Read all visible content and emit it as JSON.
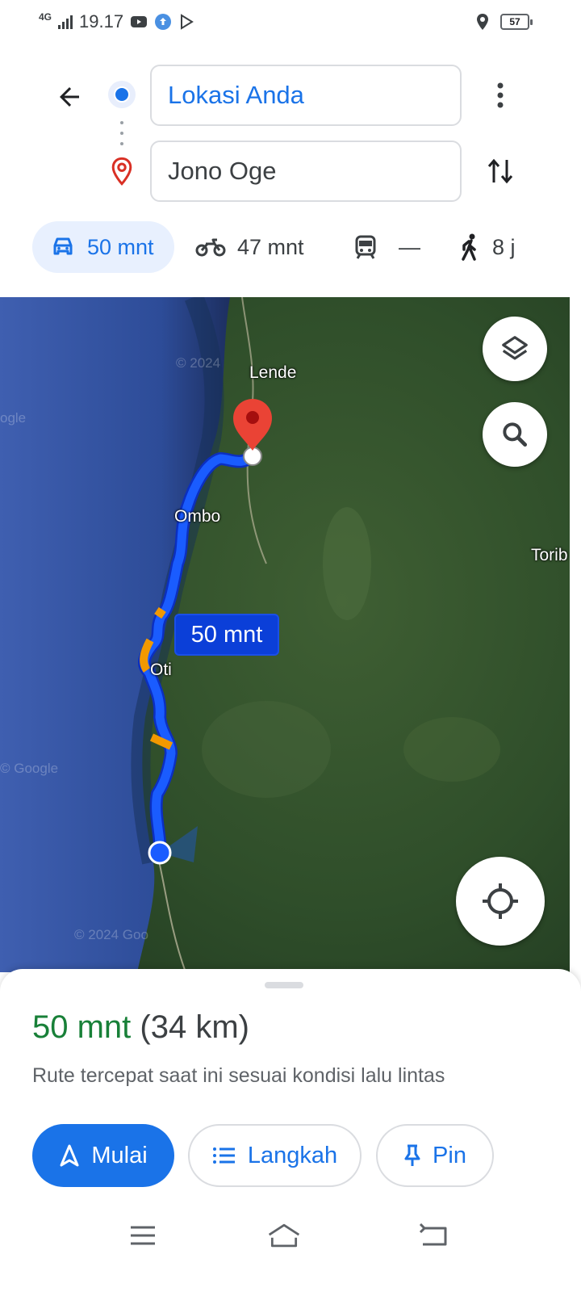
{
  "status_bar": {
    "network": "4G",
    "time": "19.17",
    "battery": "57",
    "icons": [
      "youtube-icon",
      "cloud-upload-icon",
      "play-store-icon",
      "location-icon",
      "battery-icon"
    ]
  },
  "directions": {
    "origin": "Lokasi Anda",
    "destination": "Jono Oge"
  },
  "modes": {
    "drive": "50 mnt",
    "motorcycle": "47 mnt",
    "transit": "—",
    "walk": "8 j"
  },
  "map": {
    "places": {
      "lende": "Lende",
      "ombo": "Ombo",
      "oti": "Oti",
      "toribulu": "Torib"
    },
    "route_time_label": "50 mnt",
    "watermarks": [
      "© 2024",
      "ogle",
      "© Google",
      "© 2024 Goo"
    ],
    "route_color": "#1a5cff",
    "traffic_color": "#f29900"
  },
  "sheet": {
    "duration": "50 mnt",
    "distance": "(34 km)",
    "description": "Rute tercepat saat ini sesuai kondisi lalu lintas",
    "start_label": "Mulai",
    "steps_label": "Langkah",
    "pin_label": "Pin"
  },
  "accent_color": "#1a73e8"
}
